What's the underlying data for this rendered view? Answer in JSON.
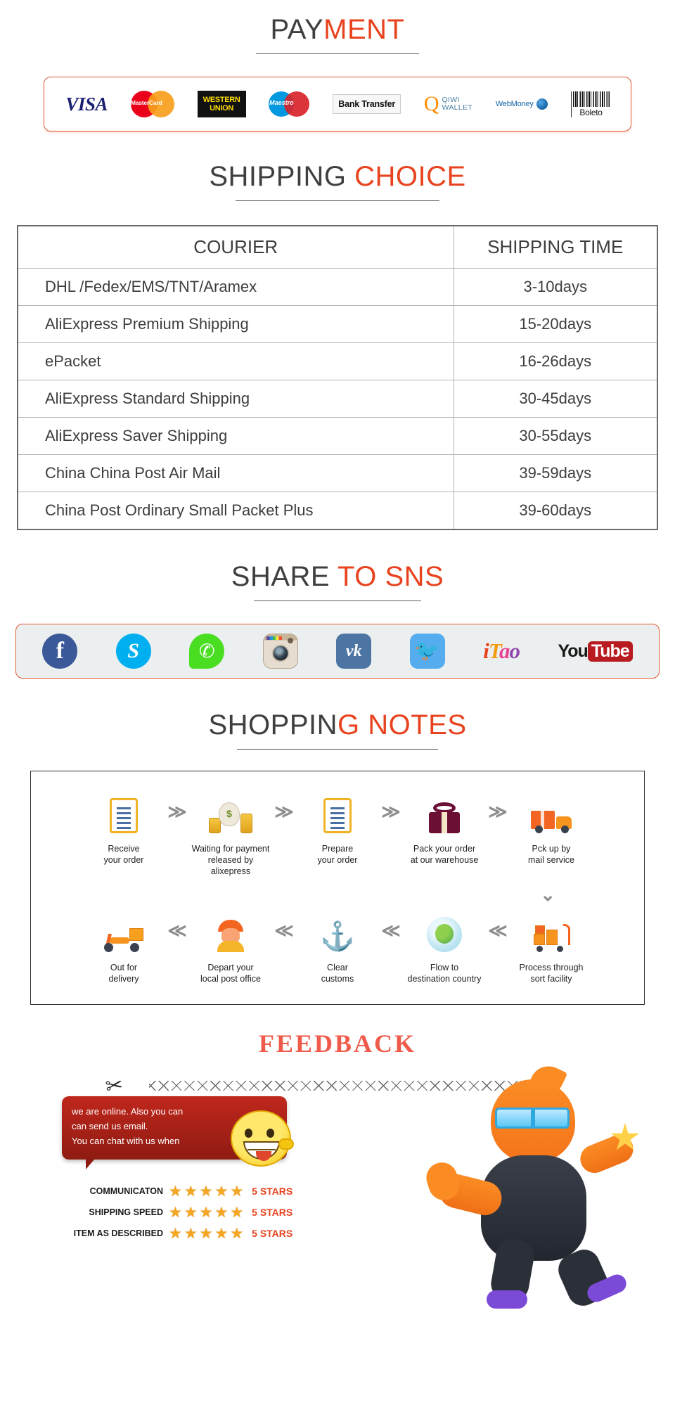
{
  "payment": {
    "title_dark": "PAY",
    "title_accent": "MENT",
    "methods": [
      {
        "name": "visa-logo",
        "label": "VISA"
      },
      {
        "name": "mastercard-logo",
        "label": "MasterCard"
      },
      {
        "name": "western-union-logo",
        "label_line1": "WESTERN",
        "label_line2": "UNION"
      },
      {
        "name": "maestro-logo",
        "label": "Maestro"
      },
      {
        "name": "bank-transfer-logo",
        "label": "Bank Transfer"
      },
      {
        "name": "qiwi-wallet-logo",
        "label_line1": "QIWI",
        "label_line2": "WALLET"
      },
      {
        "name": "webmoney-logo",
        "label": "WebMoney"
      },
      {
        "name": "boleto-logo",
        "label": "Boleto"
      }
    ]
  },
  "shipping": {
    "title_dark": "SHIPPING",
    "title_accent": " CHOICE",
    "columns": [
      "COURIER",
      "SHIPPING TIME"
    ],
    "rows": [
      {
        "courier": "DHL /Fedex/EMS/TNT/Aramex",
        "time": "3-10days"
      },
      {
        "courier": "AliExpress Premium Shipping",
        "time": "15-20days"
      },
      {
        "courier": "ePacket",
        "time": "16-26days"
      },
      {
        "courier": "AliExpress Standard Shipping",
        "time": "30-45days"
      },
      {
        "courier": "AliExpress Saver Shipping",
        "time": "30-55days"
      },
      {
        "courier": "China China Post Air Mail",
        "time": "39-59days"
      },
      {
        "courier": "China Post Ordinary Small Packet Plus",
        "time": "39-60days"
      }
    ]
  },
  "sns": {
    "title_dark": "SHARE",
    "title_accent": " TO SNS",
    "icons": [
      {
        "name": "facebook-icon",
        "label": "f"
      },
      {
        "name": "skype-icon",
        "label": "S"
      },
      {
        "name": "whatsapp-icon",
        "label": "✆"
      },
      {
        "name": "instagram-icon",
        "label": "Instagram"
      },
      {
        "name": "vk-icon",
        "label": "vk"
      },
      {
        "name": "twitter-icon",
        "label": "ᴠ"
      },
      {
        "name": "itao-icon",
        "label": "iTao"
      },
      {
        "name": "youtube-icon",
        "label_you": "You",
        "label_tube": "Tube"
      }
    ]
  },
  "notes": {
    "title_dark": "SHOPPIN",
    "title_accent": "G NOTES",
    "row1": [
      {
        "icon": "clipboard-icon",
        "label": "Receive\nyour order"
      },
      {
        "icon": "money-bag-icon",
        "label": "Waiting for payment\nreleased by alixepress"
      },
      {
        "icon": "clipboard-icon",
        "label": "Prepare\nyour order"
      },
      {
        "icon": "gift-box-icon",
        "label": "Pack your order\nat our warehouse"
      },
      {
        "icon": "delivery-truck-icon",
        "label": "Pck up by\nmail service"
      }
    ],
    "row2": [
      {
        "icon": "scooter-icon",
        "label": "Out for\ndelivery"
      },
      {
        "icon": "postman-icon",
        "label": "Depart your\nlocal post office"
      },
      {
        "icon": "anchor-icon",
        "label": "Clear\ncustoms"
      },
      {
        "icon": "globe-icon",
        "label": "Flow to\ndestination country"
      },
      {
        "icon": "sorting-cart-icon",
        "label": "Process through\nsort facility"
      }
    ],
    "chevron_right": "≫",
    "chevron_left": "≪",
    "chevron_down": "⌄"
  },
  "feedback": {
    "title": "FEEDBACK",
    "chat_lines": [
      "we are online. Also you can",
      "can send us email.",
      "You can chat with us when"
    ],
    "ratings": [
      {
        "label": "COMMUNICATON",
        "stars": 5,
        "value": "5 STARS"
      },
      {
        "label": "SHIPPING SPEED",
        "stars": 5,
        "value": "5 STARS"
      },
      {
        "label": "ITEM AS DESCRIBED",
        "stars": 5,
        "value": "5 STARS"
      }
    ],
    "star_glyph": "★"
  },
  "colors": {
    "accent": "#e8431f",
    "dark_text": "#3f3f3f",
    "border_orange": "#e05a33",
    "star": "#f5a623"
  }
}
